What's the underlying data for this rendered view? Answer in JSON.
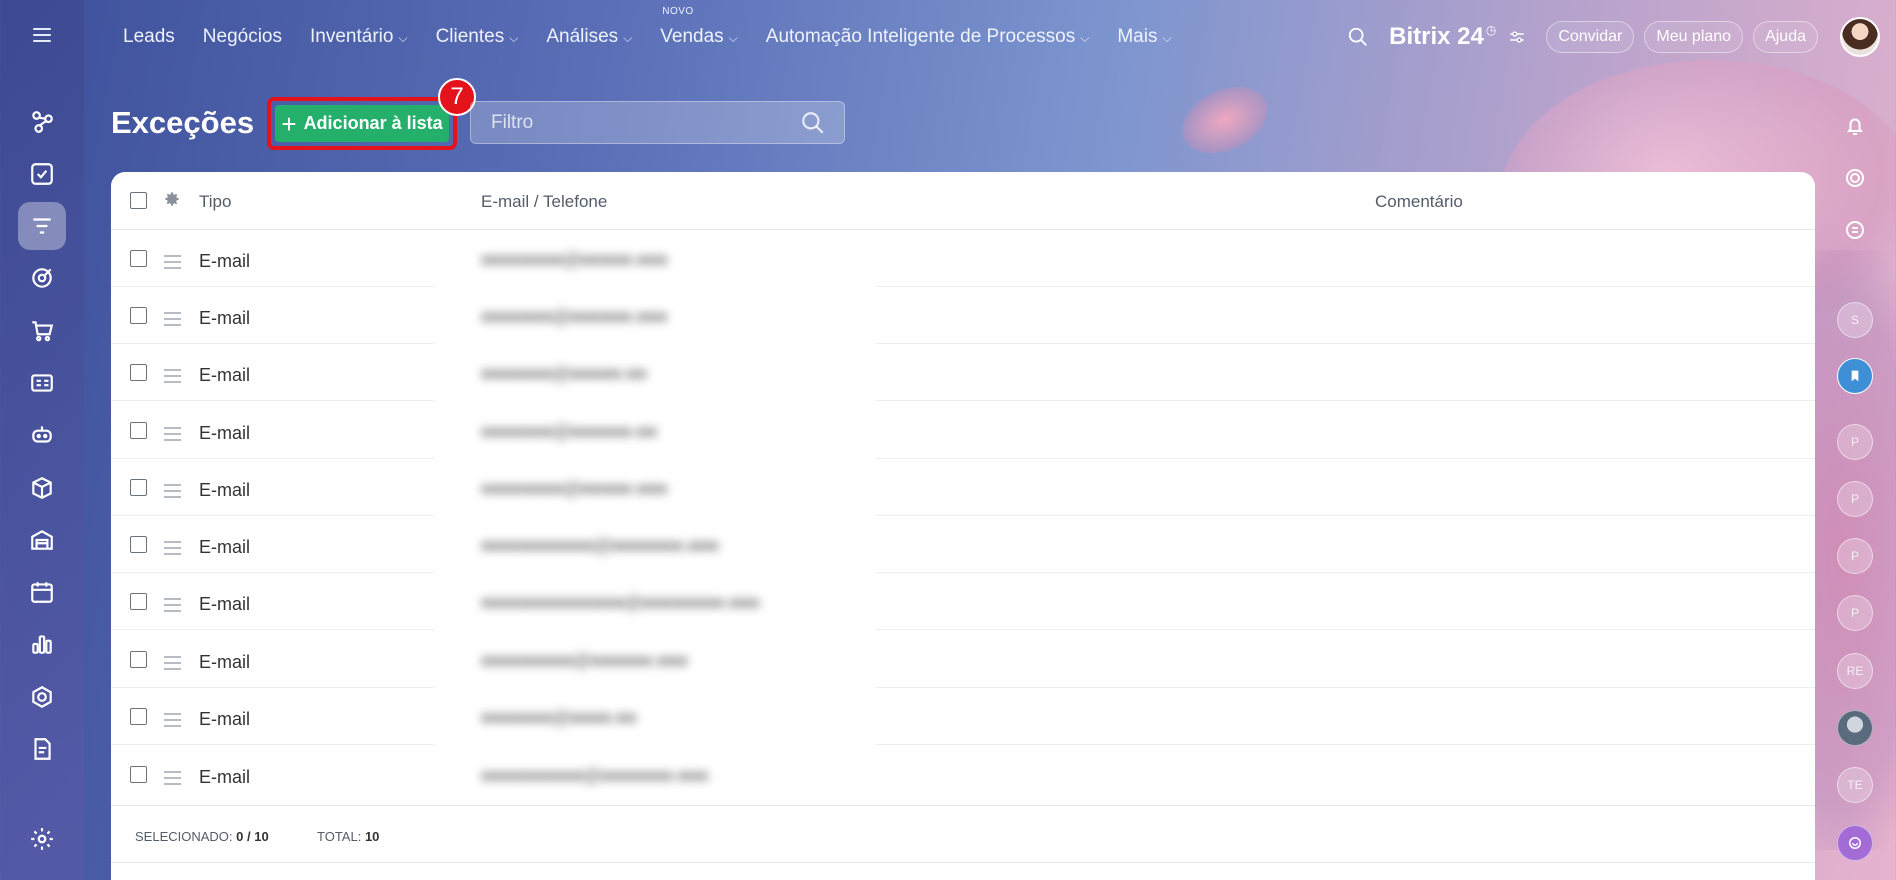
{
  "nav": {
    "items": [
      {
        "label": "Leads",
        "dropdown": false
      },
      {
        "label": "Negócios",
        "dropdown": false
      },
      {
        "label": "Inventário",
        "dropdown": true
      },
      {
        "label": "Clientes",
        "dropdown": true
      },
      {
        "label": "Análises",
        "dropdown": true
      },
      {
        "label": "Vendas",
        "dropdown": true,
        "badge": "NOVO"
      },
      {
        "label": "Automação Inteligente de Processos",
        "dropdown": true
      },
      {
        "label": "Mais",
        "dropdown": true
      }
    ],
    "brand": "Bitrix",
    "brand_number": "24",
    "invite_label": "Convidar",
    "plan_label": "Meu plano",
    "help_label": "Ajuda"
  },
  "page": {
    "title": "Exceções",
    "add_button_label": "Adicionar à lista",
    "step_number": "7",
    "filter_placeholder": "Filtro"
  },
  "table": {
    "columns": [
      "Tipo",
      "E-mail / Telefone",
      "Comentário"
    ],
    "rows": [
      {
        "type": "E-mail",
        "contact": "●●●●●●●●@●●●●●.●●●",
        "comment": ""
      },
      {
        "type": "E-mail",
        "contact": "●●●●●●●@●●●●●●.●●●",
        "comment": ""
      },
      {
        "type": "E-mail",
        "contact": "●●●●●●●@●●●●●.●●",
        "comment": ""
      },
      {
        "type": "E-mail",
        "contact": "●●●●●●●@●●●●●●.●●",
        "comment": ""
      },
      {
        "type": "E-mail",
        "contact": "●●●●●●●●@●●●●●.●●●",
        "comment": ""
      },
      {
        "type": "E-mail",
        "contact": "●●●●●●●●●●●@●●●●●●●.●●●",
        "comment": ""
      },
      {
        "type": "E-mail",
        "contact": "●●●●●●●●●●●●●●@●●●●●●●●.●●●",
        "comment": ""
      },
      {
        "type": "E-mail",
        "contact": "●●●●●●●●●@●●●●●●.●●●",
        "comment": ""
      },
      {
        "type": "E-mail",
        "contact": "●●●●●●●@●●●●.●●",
        "comment": ""
      },
      {
        "type": "E-mail",
        "contact": "●●●●●●●●●●@●●●●●●●.●●●",
        "comment": ""
      }
    ],
    "footer": {
      "selected_label": "SELECIONADO:",
      "selected_value": "0 / 10",
      "total_label": "TOTAL:",
      "total_value": "10"
    }
  },
  "right_sidebar": {
    "avatars": [
      "S",
      "",
      "P",
      "P",
      "P",
      "P",
      "RE",
      "",
      "TE",
      ""
    ]
  },
  "colors": {
    "accent_green": "#24b06b",
    "highlight_red": "#e3121b"
  },
  "icons": {
    "left_sidebar": [
      "crm-icon",
      "tasks-icon",
      "filter-icon",
      "target-icon",
      "cart-icon",
      "card-icon",
      "robot-icon",
      "box-icon",
      "warehouse-icon",
      "calendar-icon",
      "chart-icon",
      "hexagon-icon",
      "document-icon",
      "settings-icon"
    ],
    "right_sidebar": [
      "bell-icon",
      "spiral-icon",
      "chat-icon"
    ]
  }
}
